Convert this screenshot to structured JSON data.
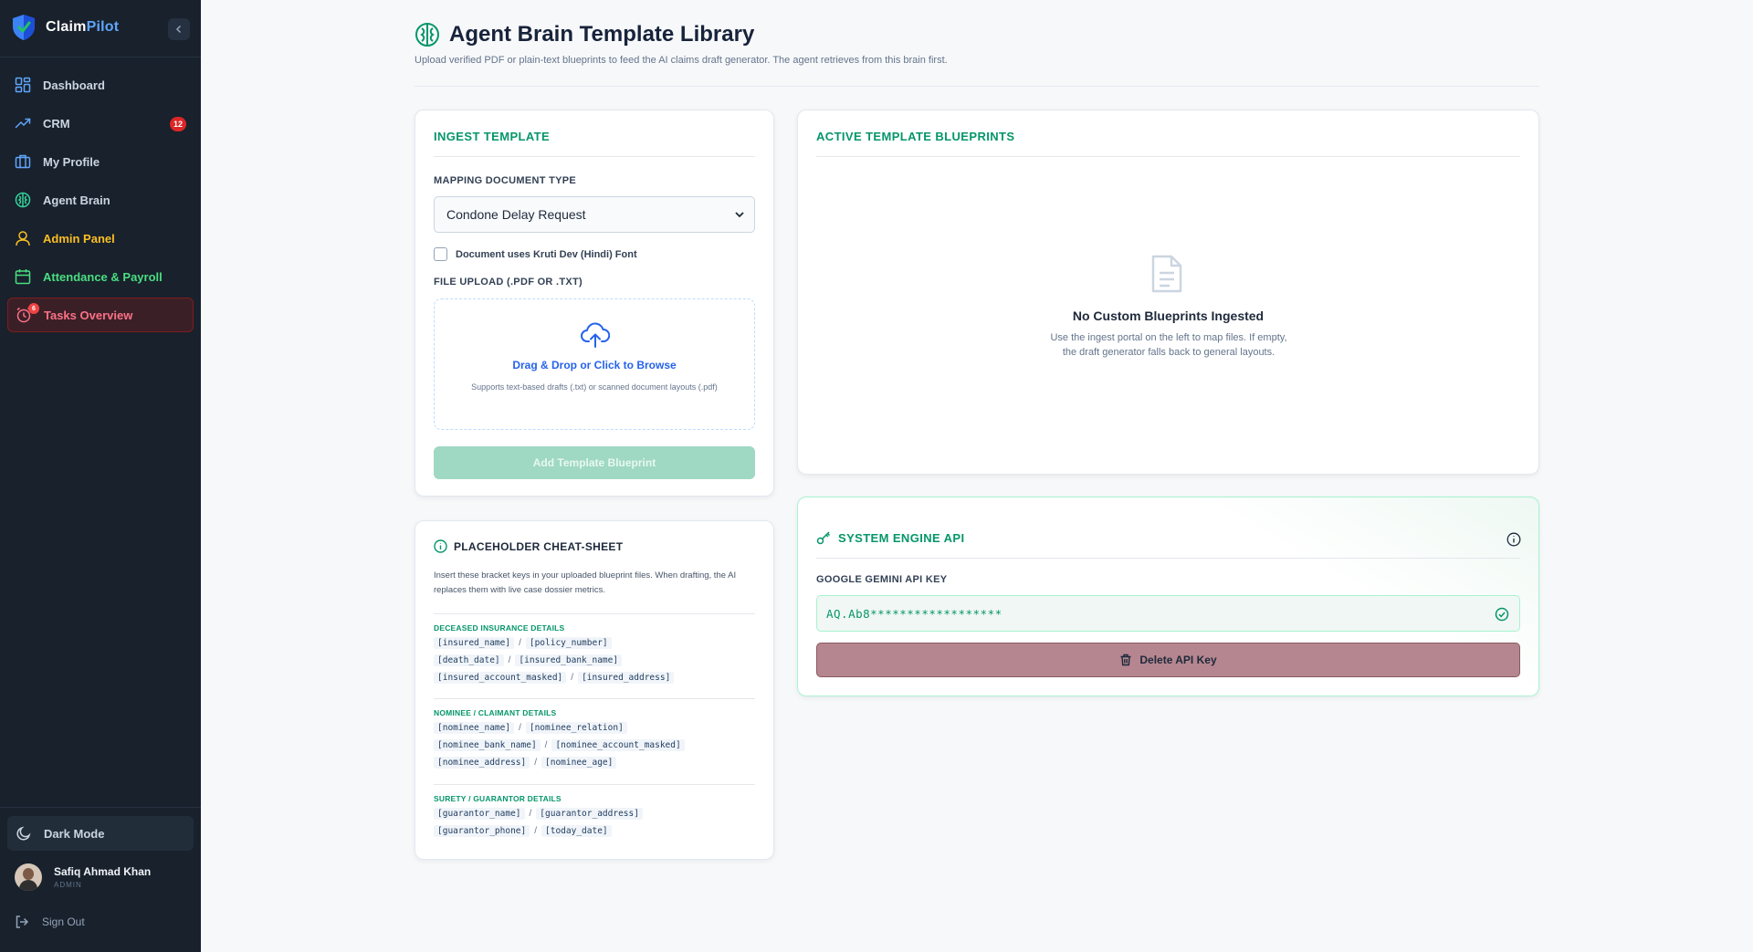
{
  "brand": {
    "name_part1": "Claim",
    "name_part2": "Pilot"
  },
  "sidebar": {
    "items": [
      {
        "label": "Dashboard"
      },
      {
        "label": "CRM",
        "badge": "12"
      },
      {
        "label": "My Profile"
      },
      {
        "label": "Agent Brain"
      },
      {
        "label": "Admin Panel"
      },
      {
        "label": "Attendance & Payroll"
      },
      {
        "label": "Tasks Overview",
        "badge": "6"
      }
    ],
    "dark_mode_label": "Dark Mode",
    "user": {
      "name": "Safiq Ahmad Khan",
      "role": "ADMIN"
    },
    "sign_out_label": "Sign Out"
  },
  "page": {
    "title": "Agent Brain Template Library",
    "subtitle": "Upload verified PDF or plain-text blueprints to feed the AI claims draft generator. The agent retrieves from this brain first."
  },
  "ingest": {
    "title": "INGEST TEMPLATE",
    "doc_type_label": "MAPPING DOCUMENT TYPE",
    "doc_type_value": "Condone Delay Request",
    "checkbox_label": "Document uses Kruti Dev (Hindi) Font",
    "upload_label": "FILE UPLOAD (.PDF OR .TXT)",
    "drop_title": "Drag & Drop or Click to Browse",
    "drop_help": "Supports text-based drafts (.txt) or scanned document layouts (.pdf)",
    "add_button": "Add Template Blueprint"
  },
  "blueprints": {
    "title": "ACTIVE TEMPLATE BLUEPRINTS",
    "empty_title": "No Custom Blueprints Ingested",
    "empty_text": "Use the ingest portal on the left to map files. If empty, the draft generator falls back to general layouts."
  },
  "cheatsheet": {
    "title": "PLACEHOLDER CHEAT-SHEET",
    "description": "Insert these bracket keys in your uploaded blueprint files. When drafting, the AI replaces them with live case dossier metrics.",
    "sections": [
      {
        "title": "DECEASED INSURANCE DETAILS",
        "rows": [
          [
            "[insured_name]",
            "[policy_number]"
          ],
          [
            "[death_date]",
            "[insured_bank_name]"
          ],
          [
            "[insured_account_masked]",
            "[insured_address]"
          ]
        ]
      },
      {
        "title": "NOMINEE / CLAIMANT DETAILS",
        "rows": [
          [
            "[nominee_name]",
            "[nominee_relation]"
          ],
          [
            "[nominee_bank_name]",
            "[nominee_account_masked]"
          ],
          [
            "[nominee_address]",
            "[nominee_age]"
          ]
        ]
      },
      {
        "title": "SURETY / GUARANTOR DETAILS",
        "rows": [
          [
            "[guarantor_name]",
            "[guarantor_address]"
          ],
          [
            "[guarantor_phone]",
            "[today_date]"
          ]
        ]
      }
    ],
    "separator": "/"
  },
  "api": {
    "title": "SYSTEM ENGINE API",
    "key_label": "GOOGLE GEMINI API KEY",
    "key_value": "AQ.Ab8******************",
    "delete_button": "Delete API Key"
  },
  "colors": {
    "accent_green": "#059669",
    "link_blue": "#2563eb",
    "sidebar_bg": "#18212c",
    "danger": "#dc2626"
  }
}
